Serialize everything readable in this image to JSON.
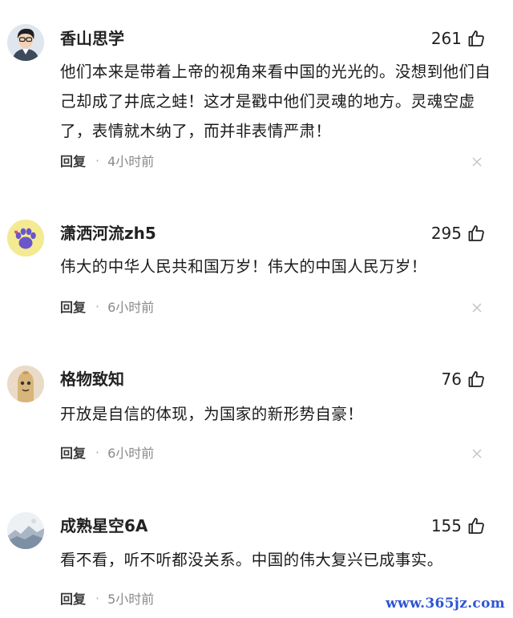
{
  "comments": [
    {
      "user": "香山思学",
      "likes": "261",
      "text": "他们本来是带着上帝的视角来看中国的光光的。没想到他们自己却成了井底之蛙！这才是戳中他们灵魂的地方。灵魂空虚了，表情就木纳了，而并非表情严肃！",
      "reply": "回复",
      "time": "4小时前",
      "avatar": "man-avatar"
    },
    {
      "user": "潇洒河流zh5",
      "likes": "295",
      "text": "伟大的中华人民共和国万岁！伟大的中国人民万岁！",
      "reply": "回复",
      "time": "6小时前",
      "avatar": "paw-avatar"
    },
    {
      "user": "格物致知",
      "likes": "76",
      "text": "开放是自信的体现，为国家的新形势自豪！",
      "reply": "回复",
      "time": "6小时前",
      "avatar": "cartoon-avatar"
    },
    {
      "user": "成熟星空6A",
      "likes": "155",
      "text": "看不看，听不听都没关系。中国的伟大复兴已成事实。",
      "reply": "回复",
      "time": "5小时前",
      "avatar": "landscape-avatar"
    }
  ],
  "separator": "·",
  "watermark": "www.365jz.com"
}
